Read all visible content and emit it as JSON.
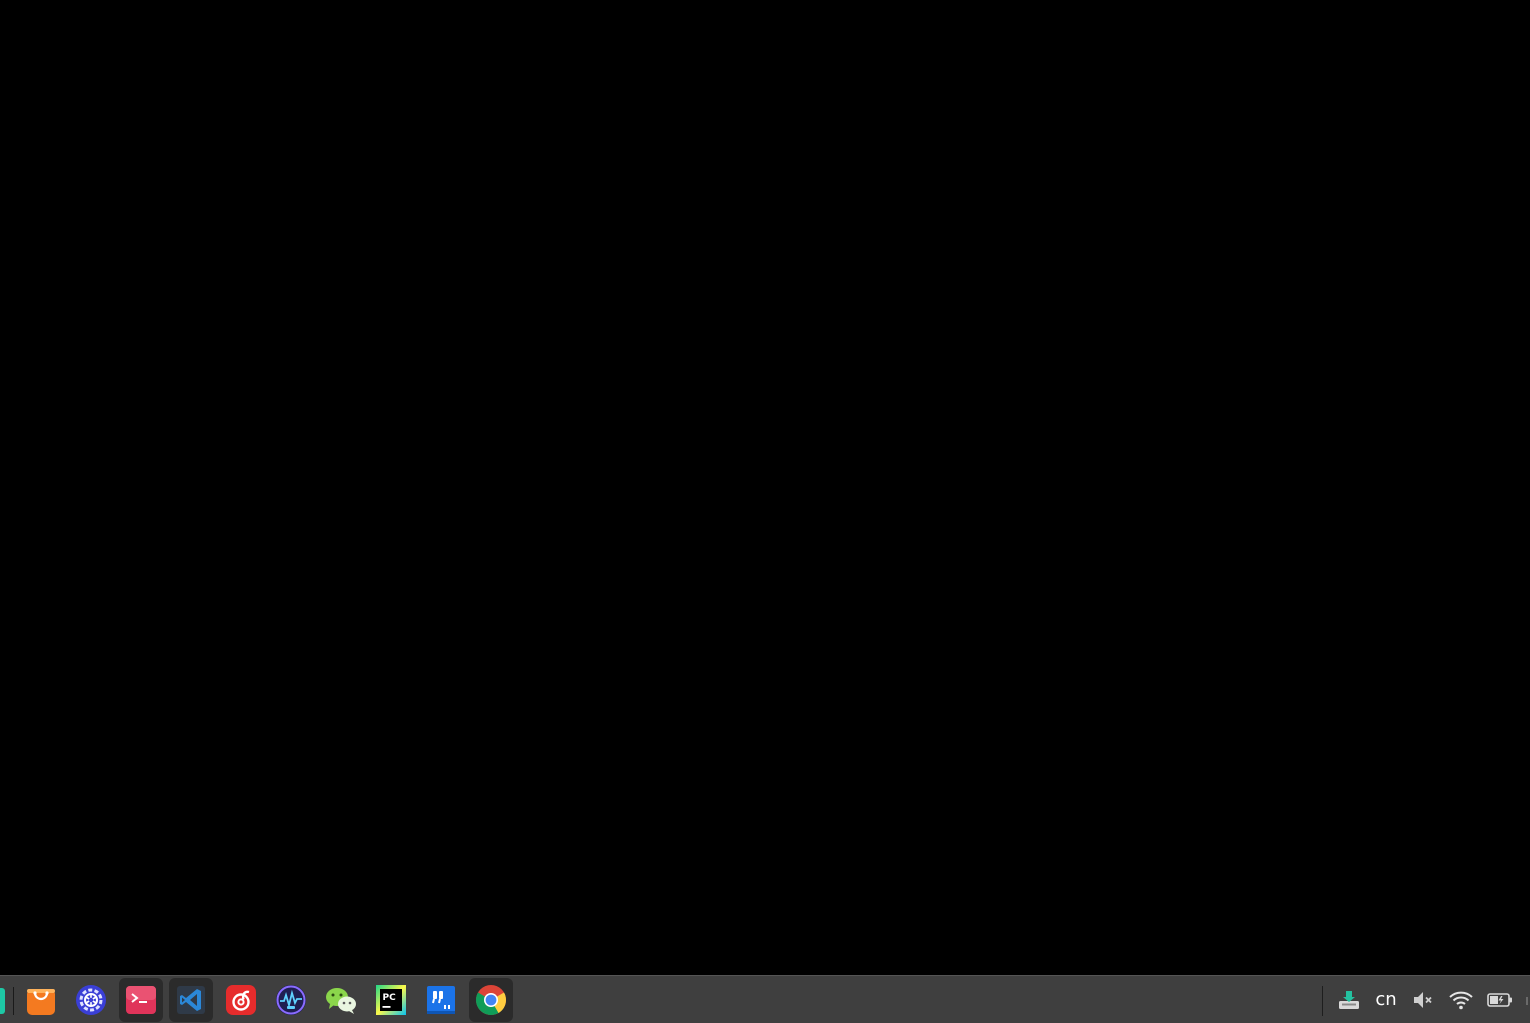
{
  "screen": {
    "background": "#000000"
  },
  "taskbar": {
    "background": "#3f3f3f",
    "apps": [
      {
        "name": "app-store",
        "icon": "shopping-bag-icon",
        "active": false
      },
      {
        "name": "control-center",
        "icon": "gear-icon",
        "active": false
      },
      {
        "name": "terminal",
        "icon": "terminal-icon",
        "active": true
      },
      {
        "name": "vscode",
        "icon": "vscode-icon",
        "active": true
      },
      {
        "name": "netease-music",
        "icon": "music-icon",
        "active": false
      },
      {
        "name": "system-monitor",
        "icon": "monitor-icon",
        "active": false
      },
      {
        "name": "wechat",
        "icon": "wechat-icon",
        "active": false
      },
      {
        "name": "pycharm",
        "icon": "pycharm-icon",
        "active": false
      },
      {
        "name": "typora",
        "icon": "quote-icon",
        "active": false
      },
      {
        "name": "chrome",
        "icon": "chrome-icon",
        "active": true
      }
    ],
    "tray": {
      "ime_label": "cn",
      "icons": [
        "screenshot-icon",
        "volume-muted-icon",
        "wifi-icon",
        "battery-icon"
      ]
    }
  }
}
